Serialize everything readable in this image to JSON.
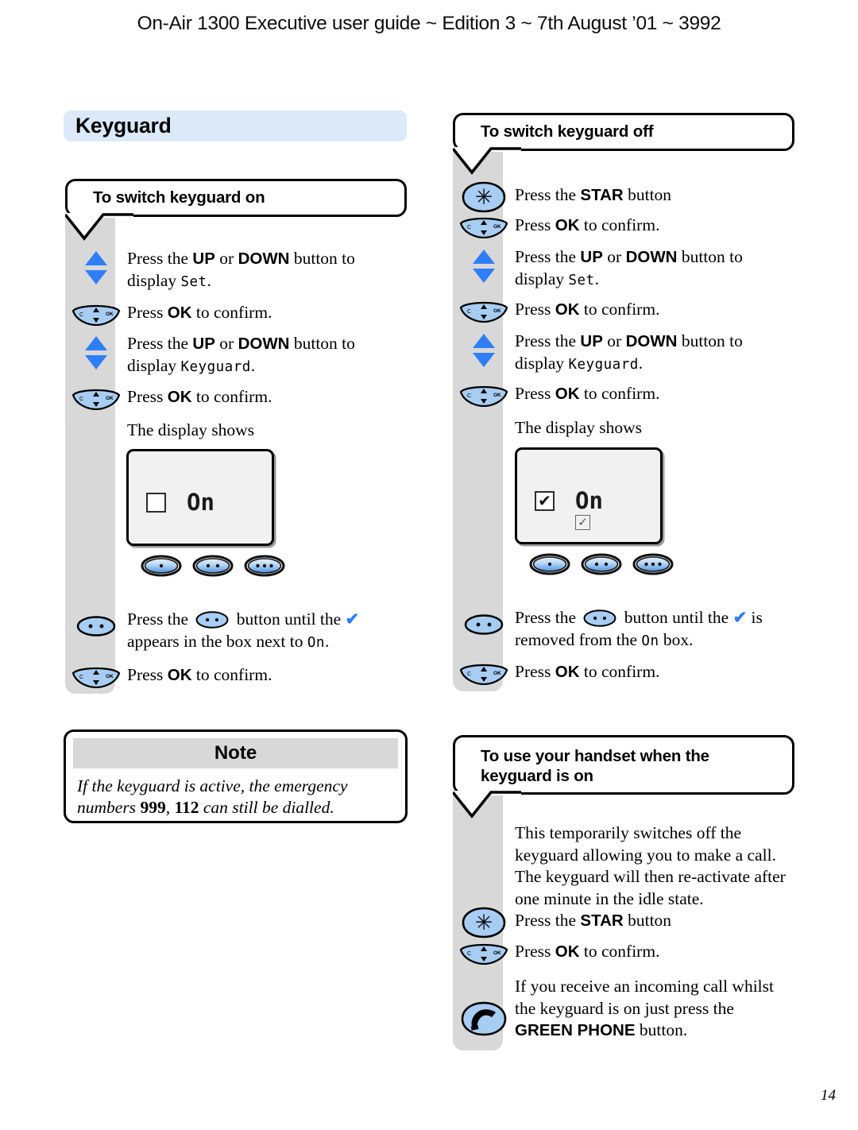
{
  "header": {
    "running_head": "On-Air 1300 Executive user guide ~ Edition 3 ~ 7th August ’01 ~ 3992"
  },
  "page": {
    "number": "14"
  },
  "section": {
    "title": "Keyguard",
    "title_bg": "#dce9f9"
  },
  "colors": {
    "accent_blue": "#2e7ef7",
    "key_blue": "#a8cdf2",
    "track_grey": "#d8d8d8",
    "lcd_grey": "#f1f1f1"
  },
  "left_column": {
    "heading": "To switch keyguard on",
    "steps": [
      {
        "icon": "up-down-arrows-icon",
        "text_pre": "Press the ",
        "bold1": "UP",
        "mid": " or ",
        "bold2": "DOWN",
        "text_post": " button to display ",
        "lcd": "Set",
        "tail": "."
      },
      {
        "icon": "ok-key-icon",
        "text_pre": "Press ",
        "bold1": "OK",
        "text_post": " to confirm."
      },
      {
        "icon": "up-down-arrows-icon",
        "text_pre": "Press the ",
        "bold1": "UP",
        "mid": " or ",
        "bold2": "DOWN",
        "text_post": " button to display ",
        "lcd": "Keyguard",
        "tail": "."
      },
      {
        "icon": "ok-key-icon",
        "text_pre": "Press ",
        "bold1": "OK",
        "text_post": " to confirm."
      }
    ],
    "display_shows_label": "The display shows",
    "lcd": {
      "checkbox": "",
      "word": "On",
      "second_box": null
    },
    "softkeys": [
      "softkey-1-dot-icon",
      "softkey-2-dot-icon",
      "softkey-3-dot-icon"
    ],
    "final_steps": [
      {
        "icon": "softkey-2-dot-icon",
        "line1_pre": "Press the ",
        "inline_icon": "softkey-2-dot-icon",
        "line1_post": " button until the ",
        "check": "✔",
        "line2": "appears in the box next to ",
        "lcd": "On",
        "line2_tail": "."
      },
      {
        "icon": "ok-key-icon",
        "text_pre": "Press ",
        "bold1": "OK",
        "text_post": " to confirm."
      }
    ]
  },
  "note": {
    "title": "Note",
    "body_pre": "If the keyguard is active, the emergency numbers ",
    "num1": "999",
    "sep": ", ",
    "num2": "112",
    "body_post": " can still be dialled."
  },
  "right_column": {
    "heading": "To switch keyguard off",
    "steps": [
      {
        "icon": "star-key-icon",
        "text_pre": "Press the ",
        "bold1": "STAR",
        "text_post": " button"
      },
      {
        "icon": "ok-key-icon",
        "text_pre": "Press ",
        "bold1": "OK",
        "text_post": " to confirm."
      },
      {
        "icon": "up-down-arrows-icon",
        "text_pre": "Press the ",
        "bold1": "UP",
        "mid": " or ",
        "bold2": "DOWN",
        "text_post": " button to display ",
        "lcd": "Set",
        "tail": "."
      },
      {
        "icon": "ok-key-icon",
        "text_pre": "Press ",
        "bold1": "OK",
        "text_post": " to confirm."
      },
      {
        "icon": "up-down-arrows-icon",
        "text_pre": "Press the ",
        "bold1": "UP",
        "mid": " or ",
        "bold2": "DOWN",
        "text_post": " button to display ",
        "lcd": "Keyguard",
        "tail": "."
      },
      {
        "icon": "ok-key-icon",
        "text_pre": "Press ",
        "bold1": "OK",
        "text_post": " to confirm."
      }
    ],
    "display_shows_label": "The display shows",
    "lcd": {
      "checkbox": "✔",
      "word": "On",
      "second_box": "✓"
    },
    "softkeys": [
      "softkey-1-dot-icon",
      "softkey-2-dot-icon",
      "softkey-3-dot-icon"
    ],
    "final_steps": [
      {
        "icon": "softkey-2-dot-icon",
        "line1_pre": "Press the ",
        "inline_icon": "softkey-2-dot-icon",
        "line1_post": " button until the ",
        "check": "✔",
        "line1_tail": " is",
        "line2": "removed from the ",
        "lcd": "On",
        "line2_tail": " box."
      },
      {
        "icon": "ok-key-icon",
        "text_pre": "Press ",
        "bold1": "OK",
        "text_post": " to confirm."
      }
    ]
  },
  "handset_section": {
    "heading_line1": "To use your handset when the",
    "heading_line2": "keyguard is on",
    "paragraph": "This temporarily switches off the keyguard allowing you to make a call. The keyguard will then re-activate after one minute in the idle state.",
    "steps": [
      {
        "icon": "star-key-icon",
        "text_pre": "Press the ",
        "bold1": "STAR",
        "text_post": " button"
      },
      {
        "icon": "ok-key-icon",
        "text_pre": "Press ",
        "bold1": "OK",
        "text_post": " to confirm."
      },
      {
        "icon": "green-phone-key-icon",
        "multiline_pre": "If you receive an incoming call whilst the keyguard is on just press the ",
        "bold1": "GREEN PHONE",
        "text_post": " button."
      }
    ]
  }
}
